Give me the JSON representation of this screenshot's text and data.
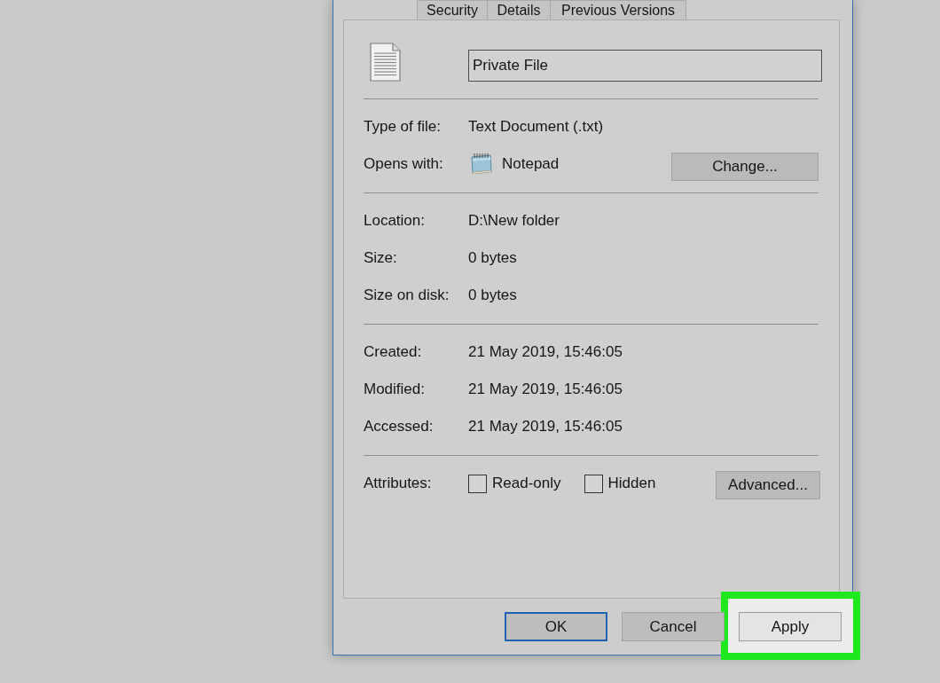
{
  "tabs": [
    {
      "label": "Security",
      "selected": false
    },
    {
      "label": "Details",
      "selected": false
    },
    {
      "label": "Previous Versions",
      "selected": false
    }
  ],
  "name_field": {
    "value": "Private File"
  },
  "sections": [
    {
      "rows": [
        {
          "kind": "text",
          "label": "Type of file:",
          "value": "Text Document (.txt)"
        },
        {
          "kind": "app",
          "label": "Opens with:",
          "value": "Notepad",
          "button": "Change..."
        }
      ]
    },
    {
      "rows": [
        {
          "kind": "text",
          "label": "Location:",
          "value": "D:\\New folder"
        },
        {
          "kind": "text",
          "label": "Size:",
          "value": "0 bytes"
        },
        {
          "kind": "text",
          "label": "Size on disk:",
          "value": "0 bytes"
        }
      ]
    },
    {
      "rows": [
        {
          "kind": "text",
          "label": "Created:",
          "value": "21 May 2019, 15:46:05"
        },
        {
          "kind": "text",
          "label": "Modified:",
          "value": "21 May 2019, 15:46:05"
        },
        {
          "kind": "text",
          "label": "Accessed:",
          "value": "21 May 2019, 15:46:05"
        }
      ]
    }
  ],
  "attributes": {
    "label": "Attributes:",
    "checkboxes": [
      {
        "label": "Read-only",
        "checked": false
      },
      {
        "label": "Hidden",
        "checked": false
      }
    ],
    "button": "Advanced..."
  },
  "buttons": [
    {
      "label": "OK",
      "default": true,
      "highlighted": false
    },
    {
      "label": "Cancel",
      "default": false,
      "highlighted": false
    },
    {
      "label": "Apply",
      "default": false,
      "highlighted": true
    }
  ]
}
